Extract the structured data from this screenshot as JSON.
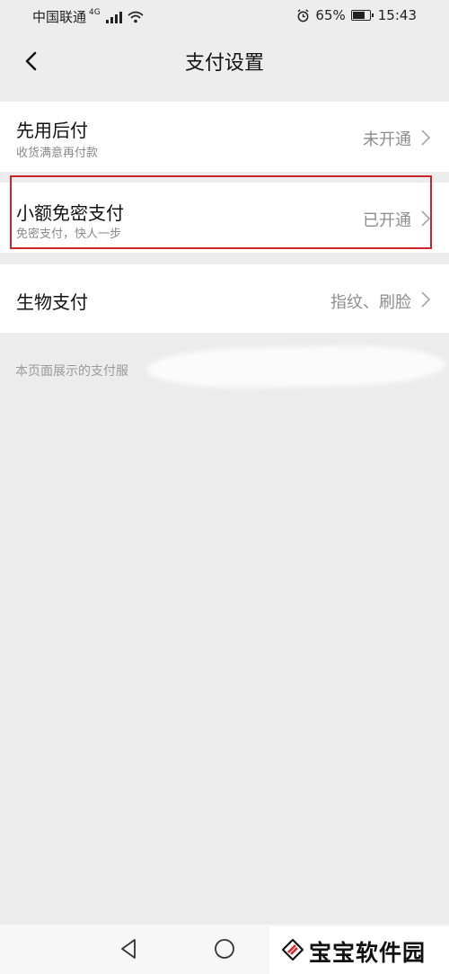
{
  "status_bar": {
    "carrier": "中国联通",
    "network": "4G",
    "battery": "65%",
    "battery_level": 0.65,
    "time": "15:43"
  },
  "header": {
    "title": "支付设置"
  },
  "settings": [
    {
      "label": "先用后付",
      "sublabel": "收货满意再付款",
      "value": "未开通"
    },
    {
      "label": "小额免密支付",
      "sublabel": "免密支付，快人一步",
      "value": "已开通"
    },
    {
      "label": "生物支付",
      "sublabel": "",
      "value": "指纹、刷脸"
    }
  ],
  "notice": {
    "text": "本页面展示的支付服"
  },
  "watermark": {
    "text": "宝宝软件园"
  }
}
